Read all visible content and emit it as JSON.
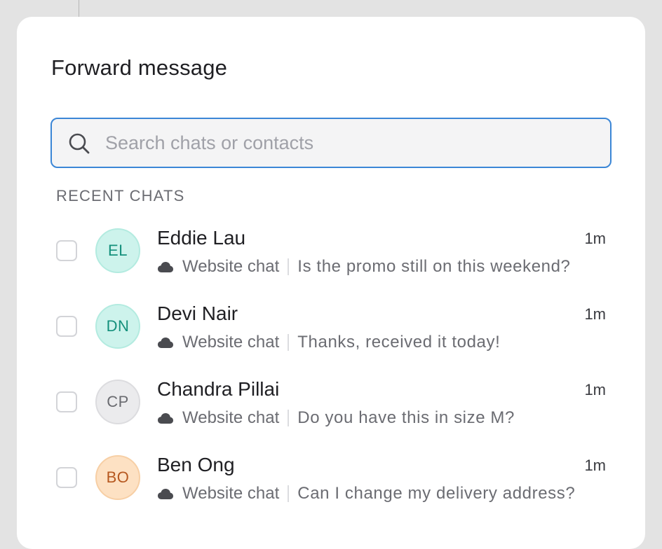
{
  "dialog": {
    "title": "Forward message"
  },
  "search": {
    "placeholder": "Search chats or contacts",
    "value": ""
  },
  "recent": {
    "section_label": "RECENT CHATS",
    "chats": [
      {
        "initials": "EL",
        "name": "Eddie Lau",
        "time": "1m",
        "channel": "Website chat",
        "preview": "Is the promo still on this weekend?",
        "avatar_bg": "#cdf3ec",
        "avatar_border": "#b3ebe0",
        "avatar_fg": "#14907c"
      },
      {
        "initials": "DN",
        "name": "Devi Nair",
        "time": "1m",
        "channel": "Website chat",
        "preview": "Thanks, received it today!",
        "avatar_bg": "#cdf3ec",
        "avatar_border": "#b3ebe0",
        "avatar_fg": "#14907c"
      },
      {
        "initials": "CP",
        "name": "Chandra Pillai",
        "time": "1m",
        "channel": "Website chat",
        "preview": "Do you have this in size M?",
        "avatar_bg": "#ebebed",
        "avatar_border": "#dcdcdf",
        "avatar_fg": "#6a6b70"
      },
      {
        "initials": "BO",
        "name": "Ben Ong",
        "time": "1m",
        "channel": "Website chat",
        "preview": "Can I change my delivery address?",
        "avatar_bg": "#fde1c3",
        "avatar_border": "#f7cfa5",
        "avatar_fg": "#b6581f"
      }
    ]
  },
  "colors": {
    "accent": "#3b86d6",
    "backdrop": "#e3e3e3"
  },
  "icons": {
    "search": "search-icon",
    "channel": "cloud-icon"
  }
}
